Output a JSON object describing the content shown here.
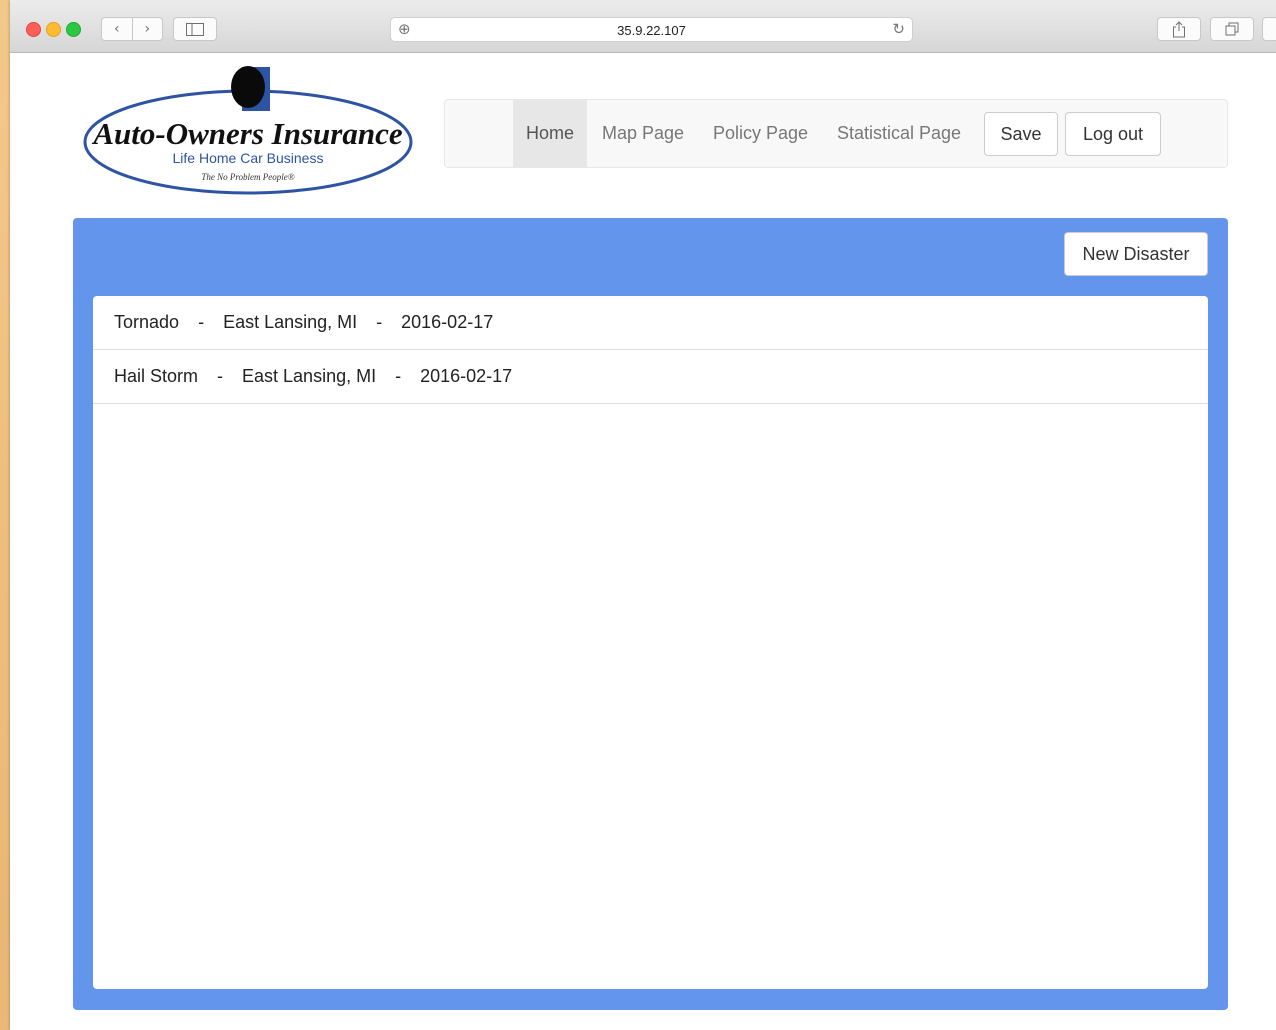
{
  "browser": {
    "url": "35.9.22.107",
    "back_glyph": "‹",
    "forward_glyph": "›"
  },
  "logo": {
    "brand": "Auto-Owners Insurance",
    "lines": "Life  Home  Car  Business",
    "tagline": "The No Problem People®"
  },
  "nav": {
    "home": "Home",
    "map": "Map Page",
    "policy": "Policy Page",
    "statistical": "Statistical Page",
    "save": "Save",
    "logout": "Log out"
  },
  "panel": {
    "new_disaster": "New Disaster",
    "separator": "-",
    "disasters": [
      {
        "type": "Tornado",
        "location": "East Lansing, MI",
        "date": "2016-02-17"
      },
      {
        "type": "Hail Storm",
        "location": "East Lansing, MI",
        "date": "2016-02-17"
      }
    ]
  },
  "colors": {
    "panel_bg": "#6495ed",
    "logo_blue": "#2d54a3"
  }
}
